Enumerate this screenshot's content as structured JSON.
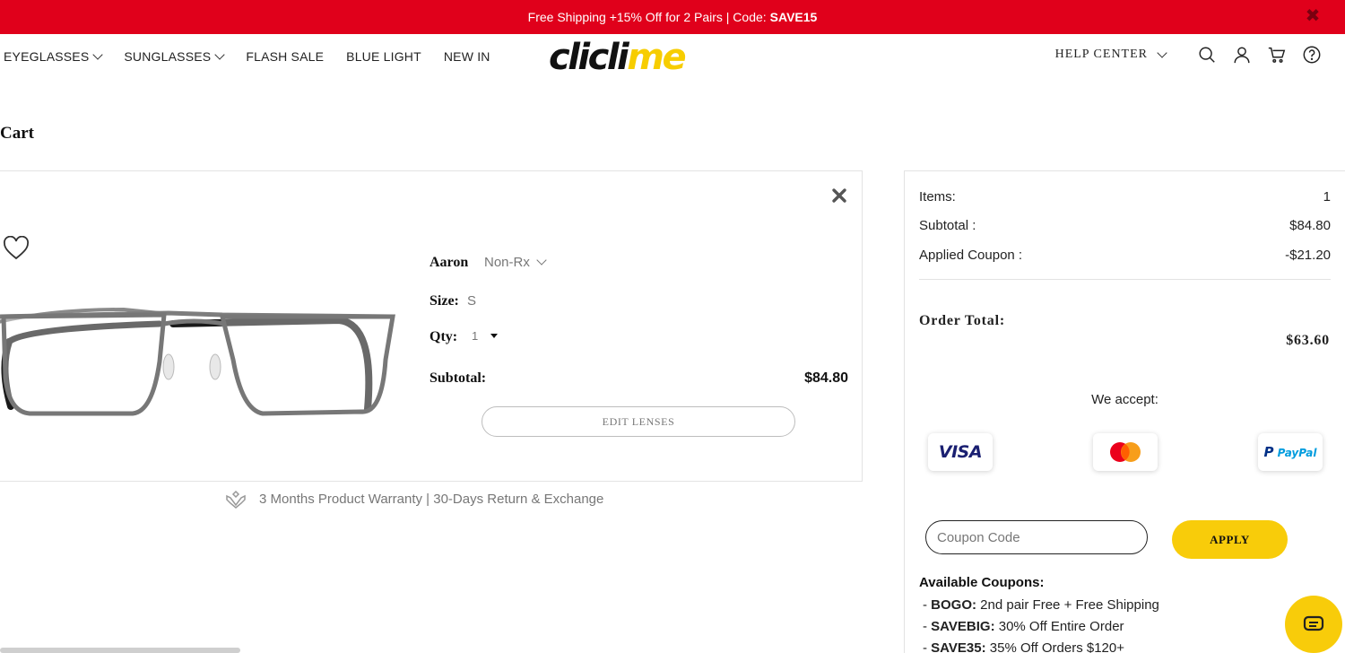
{
  "promo": {
    "text": "Free Shipping +15% Off for 2 Pairs | Code: ",
    "code": "SAVE15",
    "close_icon": "close-icon"
  },
  "nav": {
    "items": [
      {
        "label": "EYEGLASSES",
        "has_dropdown": true
      },
      {
        "label": "SUNGLASSES",
        "has_dropdown": true
      },
      {
        "label": "FLASH SALE",
        "has_dropdown": false
      },
      {
        "label": "BLUE LIGHT",
        "has_dropdown": false
      },
      {
        "label": "NEW IN",
        "has_dropdown": false
      }
    ],
    "logo": {
      "part1": "clicli",
      "part2": "me"
    },
    "help_label": "HELP CENTER",
    "icons": [
      "search-icon",
      "user-icon",
      "cart-icon",
      "help-icon"
    ]
  },
  "page": {
    "title": "Cart"
  },
  "item": {
    "name": "Aaron",
    "type": "Non-Rx",
    "size_label": "Size:",
    "size_value": "S",
    "qty_label": "Qty:",
    "qty_value": "1",
    "subtotal_label": "Subtotal:",
    "subtotal_value": "$84.80",
    "edit_lenses_label": "EDIT LENSES",
    "warranty_text": "3 Months Product Warranty | 30-Days Return & Exchange"
  },
  "summary": {
    "items_label": "Items:",
    "items_value": "1",
    "subtotal_label": "Subtotal :",
    "subtotal_value": "$84.80",
    "coupon_label": "Applied Coupon :",
    "coupon_value": "-$21.20",
    "order_total_label": "Order Total:",
    "order_total_value": "$63.60",
    "we_accept": "We accept:",
    "payments": [
      "VISA",
      "MasterCard",
      "PayPal"
    ],
    "coupon_placeholder": "Coupon Code",
    "apply_label": "APPLY",
    "available_title": "Available Coupons:",
    "available": [
      {
        "code": "BOGO:",
        "desc": " 2nd pair Free + Free Shipping"
      },
      {
        "code": "SAVEBIG:",
        "desc": " 30% Off Entire Order"
      },
      {
        "code": "SAVE35:",
        "desc": " 35% Off Orders $120+"
      }
    ]
  },
  "colors": {
    "promo_bg": "#e0001b",
    "accent_yellow": "#f8cc0a",
    "logo_dark": "#111111",
    "logo_yellow": "#f7cd00"
  }
}
